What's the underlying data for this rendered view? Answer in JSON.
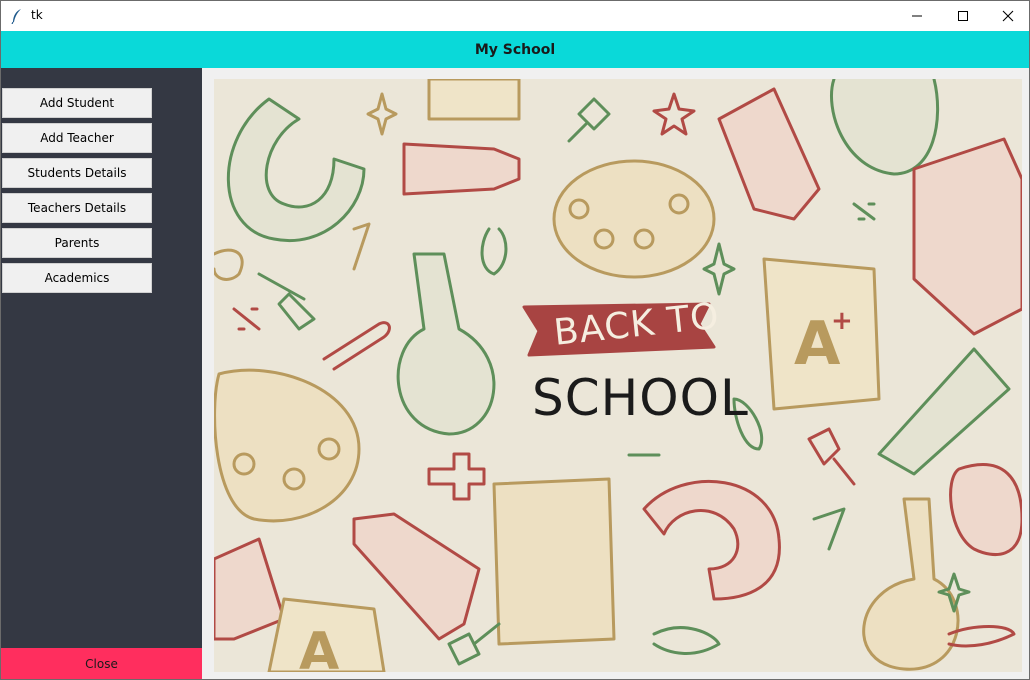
{
  "window": {
    "title": "tk"
  },
  "header": {
    "title": "My School"
  },
  "sidebar": {
    "items": [
      {
        "label": "Add Student"
      },
      {
        "label": "Add Teacher"
      },
      {
        "label": "Students Details"
      },
      {
        "label": "Teachers Details"
      },
      {
        "label": "Parents"
      },
      {
        "label": "Academics"
      }
    ],
    "close_label": "Close"
  },
  "banner": {
    "line1": "BACK TO",
    "line2": "SCHOOL"
  },
  "colors": {
    "header_bg": "#0ad9d9",
    "sidebar_bg": "#343843",
    "close_bg": "#ff2e5e",
    "banner_bg": "#ebe6d8",
    "doodle_green": "#5e8f5a",
    "doodle_red": "#b14a45",
    "doodle_tan": "#b89a5e"
  }
}
